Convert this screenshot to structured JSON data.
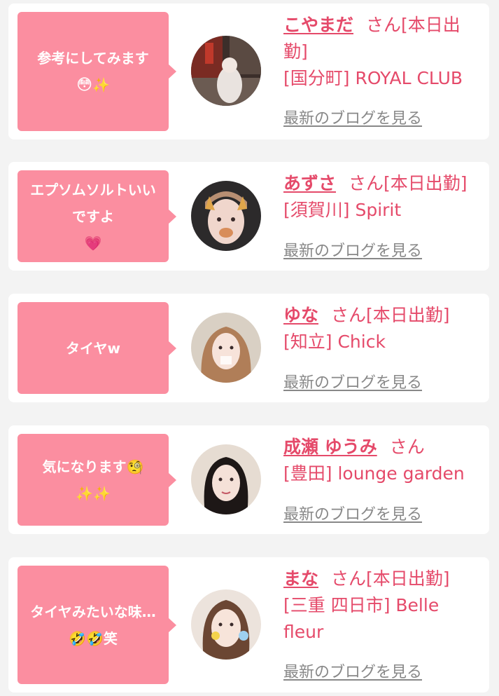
{
  "cards": [
    {
      "comment": "参考にしてみます",
      "comment_emoji": "flushed-face-emoji sparkles-emoji",
      "name": "こやまだ",
      "suffix": "さん[本日出勤]",
      "shop": "[国分町] ROYAL CLUB",
      "blog": "最新のブログを見る"
    },
    {
      "comment": "エプソムソルトいいですよ",
      "comment_emoji": "growing-heart-emoji",
      "name": "あずさ",
      "suffix": "さん[本日出勤]",
      "shop": "[須賀川] Spirit",
      "blog": "最新のブログを見る"
    },
    {
      "comment": "タイヤw",
      "name": "ゆな",
      "suffix": "さん[本日出勤]",
      "shop": "[知立] Chick",
      "blog": "最新のブログを見る"
    },
    {
      "comment": "気になります",
      "comment_emoji": "face-with-monocle-emoji sparkles-emoji sparkles-emoji",
      "name": "成瀬 ゆうみ",
      "suffix": "さん",
      "shop": "[豊田] lounge garden",
      "blog": "最新のブログを見る"
    },
    {
      "comment": "タイヤみたいな味…",
      "comment_tail": "笑",
      "comment_emoji": "rolling-laughing-emoji rolling-laughing-emoji",
      "name": "まな",
      "suffix": "さん[本日出勤]",
      "shop": "[三重 四日市] Belle fleur",
      "blog": "最新のブログを見る"
    }
  ],
  "colors": {
    "background": "#f3f3f3",
    "bubble": "#fb8ea0",
    "name": "#e54a6a",
    "link": "#888888"
  }
}
